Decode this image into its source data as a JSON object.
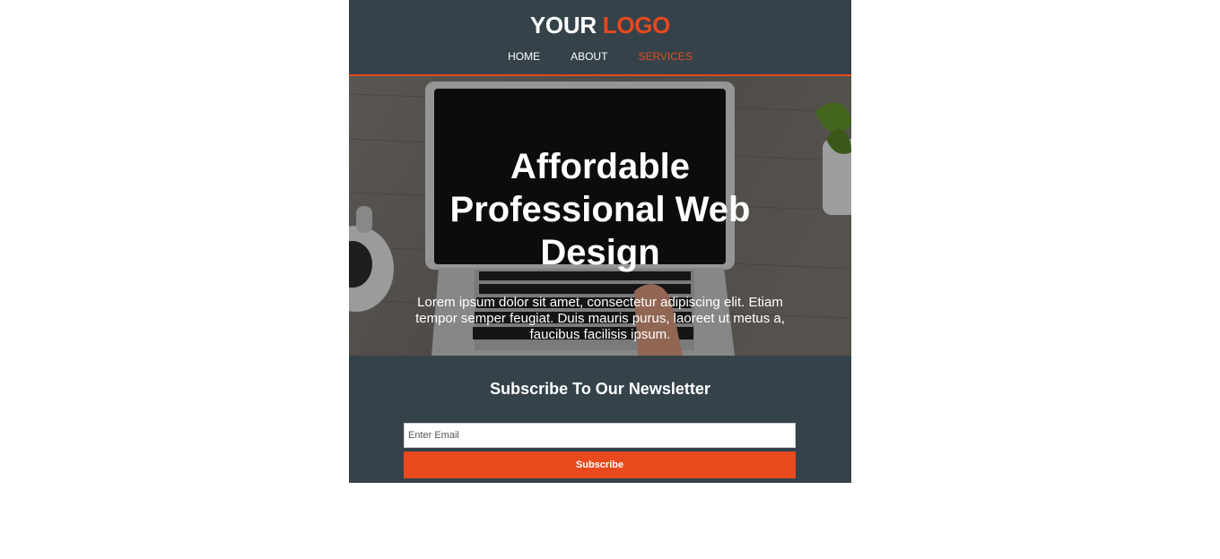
{
  "header": {
    "logo_primary": "YOUR",
    "logo_highlight": "LOGO",
    "nav": [
      {
        "label": "HOME",
        "active": false
      },
      {
        "label": "ABOUT",
        "active": false
      },
      {
        "label": "SERVICES",
        "active": true
      }
    ]
  },
  "hero": {
    "title": "Affordable Professional Web Design",
    "text": "Lorem ipsum dolor sit amet, consectetur adipiscing elit. Etiam tempor semper feugiat. Duis mauris purus, laoreet ut metus a, faucibus facilisis ipsum."
  },
  "newsletter": {
    "title": "Subscribe To Our Newsletter",
    "email_placeholder": "Enter Email",
    "email_value": "",
    "button_label": "Subscribe"
  },
  "colors": {
    "dark": "#35424a",
    "accent": "#e8491d",
    "text_light": "#ffffff"
  }
}
